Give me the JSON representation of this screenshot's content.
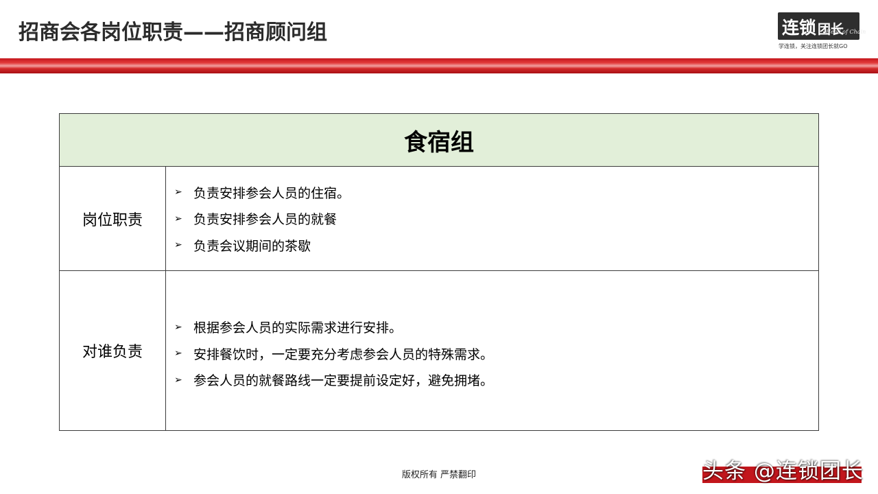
{
  "header": {
    "title": "招商会各岗位职责——招商顾问组"
  },
  "logo": {
    "main": "连锁",
    "suffix": "团长",
    "sub": "Head of Chain",
    "slogan": "学连锁，关注连锁团长就GO"
  },
  "colors": {
    "band_red": "#c4161c",
    "table_header_bg": "#e2efd9",
    "logo_bg": "#2e2e2e"
  },
  "table": {
    "title": "食宿组",
    "rows": [
      {
        "label": "岗位职责",
        "items": [
          "负责安排参会人员的住宿。",
          "负责安排参会人员的就餐",
          "负责会议期间的茶歇"
        ]
      },
      {
        "label": "对谁负责",
        "items": [
          "根据参会人员的实际需求进行安排。",
          "安排餐饮时，一定要充分考虑参会人员的特殊需求。",
          "参会人员的就餐路线一定要提前设定好，避免拥堵。"
        ]
      }
    ],
    "bullet_icon": "arrow-bullet-icon"
  },
  "footer": {
    "copyright": "版权所有  严禁翻印"
  },
  "watermark": {
    "text": "头条 @连锁团长"
  }
}
